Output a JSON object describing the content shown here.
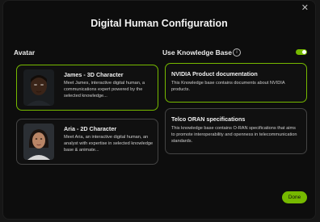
{
  "dialog": {
    "title": "Digital Human Configuration",
    "close_icon": "close-icon"
  },
  "avatar_section": {
    "label": "Avatar",
    "items": [
      {
        "title": "James - 3D Character",
        "description": "Meet James, interactive digital human, a communications expert powered by the selected knowledge...",
        "selected": true
      },
      {
        "title": "Aria - 2D Character",
        "description": "Meet Aria, an interactive digital human, an analyst with expertise in selected knowledge base & animate...",
        "selected": false
      }
    ]
  },
  "knowledge_section": {
    "label": "Use Knowledge Base",
    "info_icon": "info-icon",
    "toggle_on": true,
    "items": [
      {
        "title": "NVIDIA Product documentation",
        "description": "This Knowledge base contains documents about NVIDIA products.",
        "selected": true
      },
      {
        "title": "Telco ORAN specifications",
        "description": "This knowledge base contains O-RAN specifications that aims to promote interoperability and openness in telecommunication standards.",
        "selected": false
      }
    ]
  },
  "footer": {
    "done_label": "Done"
  },
  "colors": {
    "accent": "#76b900",
    "background": "#0d0d0d",
    "card_border": "#444444"
  }
}
